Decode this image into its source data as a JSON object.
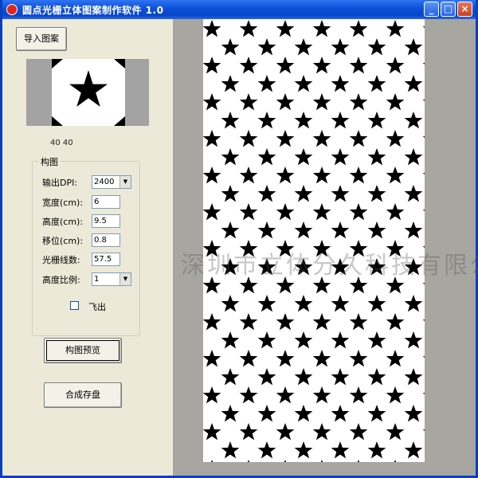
{
  "window": {
    "title": "圆点光栅立体图案制作软件 1.0",
    "controls": {
      "minimize": "_",
      "maximize": "□",
      "close": "×"
    }
  },
  "left_panel": {
    "import_button": "导入图案",
    "image_size": "40 40",
    "group_title": "构图",
    "fields": {
      "dpi": {
        "label": "输出DPI:",
        "value": "2400"
      },
      "width": {
        "label": "宽度(cm):",
        "value": "6"
      },
      "height": {
        "label": "高度(cm):",
        "value": "9.5"
      },
      "offset": {
        "label": "移位(cm):",
        "value": "0.8"
      },
      "lpi": {
        "label": "光栅线数:",
        "value": "57.5"
      },
      "ratio": {
        "label": "高度比例:",
        "value": "1"
      }
    },
    "fly_out": {
      "label": "飞出",
      "checked": false
    },
    "preview_button": "构图预览",
    "save_button": "合成存盘"
  },
  "canvas": {
    "watermark": "深圳市立体分久科技有限公司"
  }
}
